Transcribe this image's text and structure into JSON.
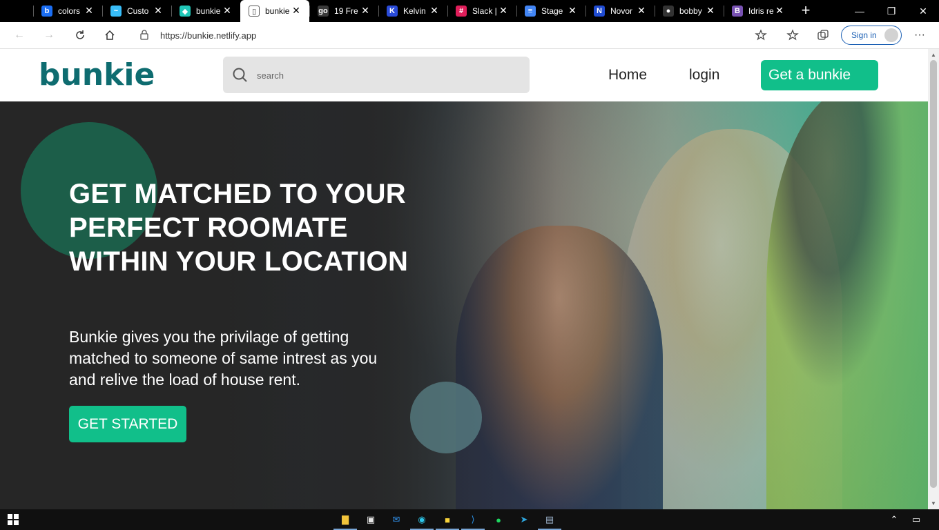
{
  "browser": {
    "tabs": [
      {
        "title": "colors",
        "icon": "bing-icon",
        "color": "#1b6ef3",
        "glyph": "b",
        "active": false
      },
      {
        "title": "Custo",
        "icon": "tailwind-icon",
        "color": "#38bdf8",
        "glyph": "~",
        "active": false
      },
      {
        "title": "bunkie",
        "icon": "netlify-icon",
        "color": "#20c6b7",
        "glyph": "◆",
        "active": false
      },
      {
        "title": "bunkie",
        "icon": "page-icon",
        "color": "#ffffff",
        "glyph": "▯",
        "active": true
      },
      {
        "title": "19 Fre",
        "icon": "go-icon",
        "color": "#3a3a3a",
        "glyph": "go",
        "active": false
      },
      {
        "title": "Kelvin",
        "icon": "kelvin-icon",
        "color": "#2a4bd8",
        "glyph": "K",
        "active": false
      },
      {
        "title": "Slack |",
        "icon": "slack-icon",
        "color": "#e01e5a",
        "glyph": "#",
        "active": false
      },
      {
        "title": "Stage",
        "icon": "docs-icon",
        "color": "#4285f4",
        "glyph": "≡",
        "active": false
      },
      {
        "title": "Novor",
        "icon": "novu-icon",
        "color": "#1f4bd1",
        "glyph": "N",
        "active": false
      },
      {
        "title": "bobby",
        "icon": "github-icon",
        "color": "#333333",
        "glyph": "●",
        "active": false
      },
      {
        "title": "Idris re",
        "icon": "bootstrap-icon",
        "color": "#7952b3",
        "glyph": "B",
        "active": false
      }
    ],
    "url": "https://bunkie.netlify.app",
    "sign_in": "Sign in"
  },
  "site": {
    "logo": "bunkie",
    "search_placeholder": "search",
    "nav": {
      "home": "Home",
      "login": "login",
      "cta": "Get a bunkie"
    },
    "hero": {
      "headline": "GET MATCHED TO YOUR PERFECT ROOMATE WITHIN YOUR LOCATION",
      "subtext": "Bunkie gives you the privilage of getting matched to someone of same intrest as you and relive the load of house rent.",
      "button": "GET STARTED"
    },
    "colors": {
      "brand_teal": "#0e6c70",
      "accent_green": "#11bf8a",
      "hero_bg": "#262626",
      "circle": "#1c5e49"
    }
  },
  "taskbar": {
    "apps": [
      "file-explorer-icon",
      "store-icon",
      "mail-icon",
      "edge-icon",
      "sticky-notes-icon",
      "vscode-icon",
      "spotify-icon",
      "telegram-icon",
      "remote-desktop-icon"
    ]
  }
}
